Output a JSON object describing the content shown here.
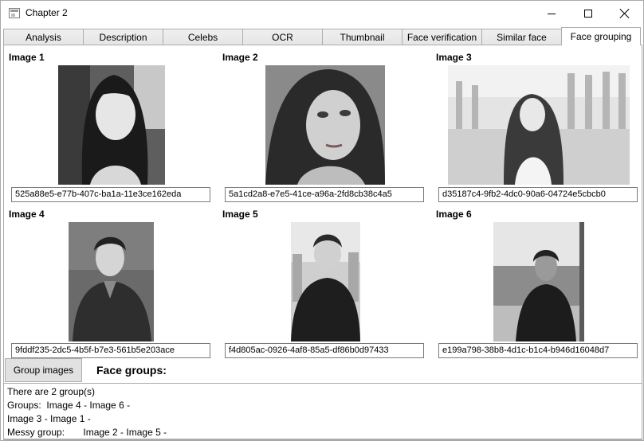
{
  "window": {
    "title": "Chapter 2"
  },
  "tabs": [
    {
      "label": "Analysis"
    },
    {
      "label": "Description"
    },
    {
      "label": "Celebs"
    },
    {
      "label": "OCR"
    },
    {
      "label": "Thumbnail"
    },
    {
      "label": "Face verification"
    },
    {
      "label": "Similar face"
    },
    {
      "label": "Face grouping",
      "active": true
    }
  ],
  "images": [
    {
      "label": "Image 1",
      "face_id": "525a88e5-e77b-407c-ba1a-11e3ce162eda"
    },
    {
      "label": "Image 2",
      "face_id": "5a1cd2a8-e7e5-41ce-a96a-2fd8cb38c4a5"
    },
    {
      "label": "Image 3",
      "face_id": "d35187c4-9fb2-4dc0-90a6-04724e5cbcb0"
    },
    {
      "label": "Image 4",
      "face_id": "9fddf235-2dc5-4b5f-b7e3-561b5e203ace"
    },
    {
      "label": "Image 5",
      "face_id": "f4d805ac-0926-4af8-85a5-df86b0d97433"
    },
    {
      "label": "Image 6",
      "face_id": "e199a798-38b8-4d1c-b1c4-b946d16048d7"
    }
  ],
  "controls": {
    "group_button_label": "Group images",
    "groups_heading": "Face groups:"
  },
  "results": {
    "lines": [
      "There are 2 group(s)",
      "Groups:  Image 4 - Image 6 -",
      "Image 3 - Image 1 -",
      "Messy group:       Image 2 - Image 5 -"
    ]
  }
}
